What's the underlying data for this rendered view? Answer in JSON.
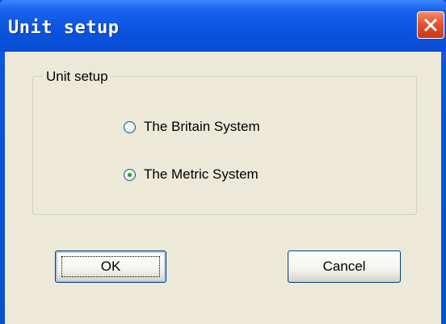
{
  "window": {
    "title": "Unit setup",
    "close_icon": "close-x-icon"
  },
  "group": {
    "label": "Unit setup"
  },
  "options": [
    {
      "label": "The Britain System",
      "selected": false
    },
    {
      "label": "The Metric System",
      "selected": true
    }
  ],
  "buttons": {
    "ok": "OK",
    "cancel": "Cancel"
  },
  "colors": {
    "titlebar": "#0b54e0",
    "dialog_bg": "#ece9d8",
    "close_button": "#e1502b",
    "radio_selected": "#21a121"
  }
}
